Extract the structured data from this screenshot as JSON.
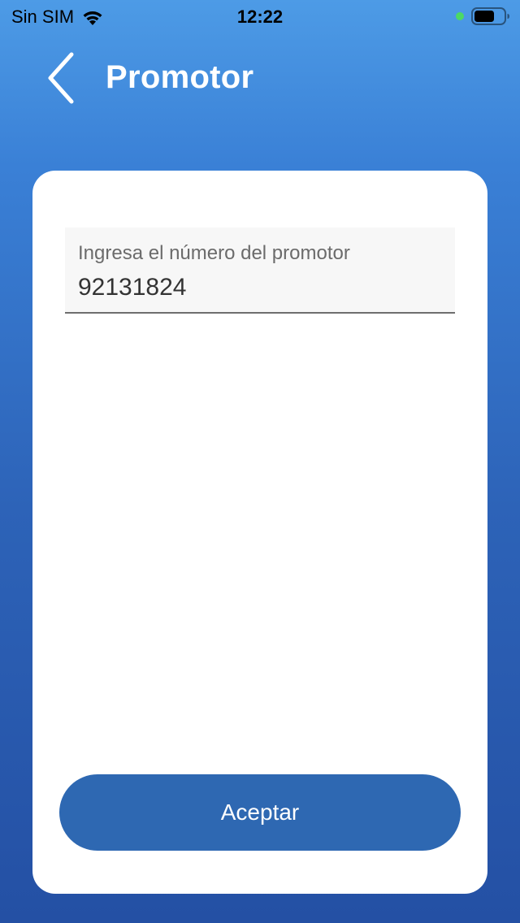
{
  "status_bar": {
    "carrier": "Sin SIM",
    "time": "12:22",
    "wifi_icon": "wifi-icon",
    "battery_icon": "battery-icon",
    "indicator_color": "#4cd964"
  },
  "nav": {
    "back_icon": "chevron-left-icon",
    "title": "Promotor"
  },
  "form": {
    "promoter_field": {
      "label": "Ingresa el número del promotor",
      "value": "92131824"
    },
    "accept_label": "Aceptar"
  },
  "colors": {
    "gradient_top": "#4d9be6",
    "gradient_bottom": "#2450a4",
    "button": "#2e68b2",
    "card": "#ffffff"
  }
}
